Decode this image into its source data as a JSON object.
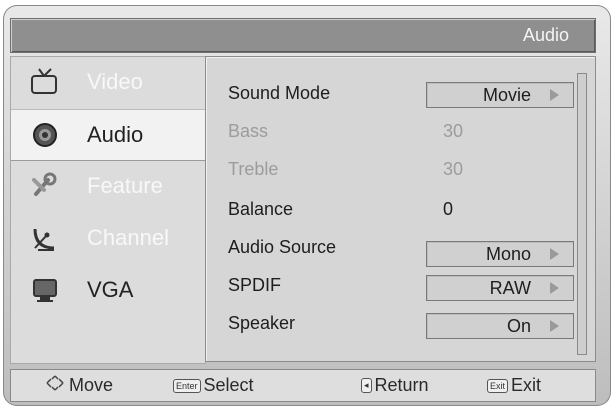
{
  "header": {
    "title": "Audio"
  },
  "sidebar": {
    "items": [
      {
        "label": "Video",
        "icon": "tv-icon"
      },
      {
        "label": "Audio",
        "icon": "speaker-icon"
      },
      {
        "label": "Feature",
        "icon": "wrench-icon"
      },
      {
        "label": "Channel",
        "icon": "satellite-icon"
      },
      {
        "label": "VGA",
        "icon": "monitor-icon"
      }
    ],
    "active": "Audio"
  },
  "settings": {
    "sound_mode": {
      "label": "Sound Mode",
      "value": "Movie"
    },
    "bass": {
      "label": "Bass",
      "value": "30"
    },
    "treble": {
      "label": "Treble",
      "value": "30"
    },
    "balance": {
      "label": "Balance",
      "value": "0"
    },
    "audio_source": {
      "label": "Audio Source",
      "value": "Mono"
    },
    "spdif": {
      "label": "SPDIF",
      "value": "RAW"
    },
    "speaker": {
      "label": "Speaker",
      "value": "On"
    }
  },
  "footer": {
    "move": "Move",
    "select_key": "Enter",
    "select": "Select",
    "return": "Return",
    "exit_key": "Exit",
    "exit": "Exit"
  }
}
